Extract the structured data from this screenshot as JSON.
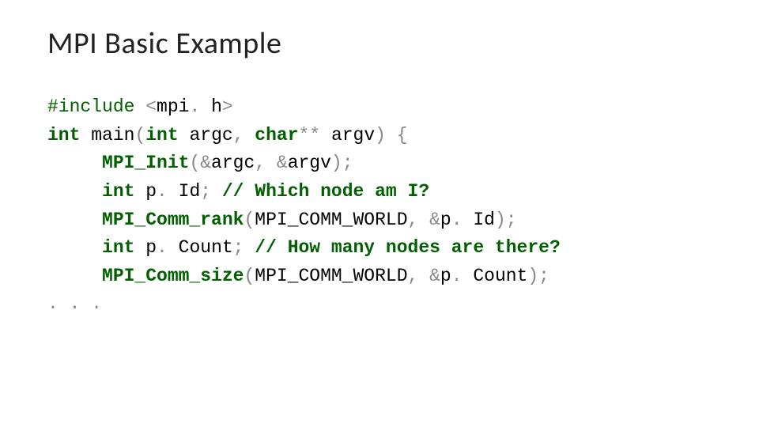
{
  "title": "MPI Basic Example",
  "code": {
    "l1_include": "#include ",
    "l1_lt": "<",
    "l1_hdr": "mpi",
    "l1_dot": ". ",
    "l1_h": "h",
    "l1_gt": ">",
    "l2_int": "int",
    "l2_main": " main",
    "l2_op": "(",
    "l2_int2": "int",
    "l2_argc": " argc",
    "l2_comma": ", ",
    "l2_char": "char",
    "l2_stars": "** ",
    "l2_argv": "argv",
    "l2_cp": ") {",
    "l3_indent": "     ",
    "l3_fn": "MPI_Init",
    "l3_op": "(&",
    "l3_argc": "argc",
    "l3_mid": ", &",
    "l3_argv": "argv",
    "l3_cp": ");",
    "l4_indent": "     ",
    "l4_int": "int",
    "l4_pid_a": " p",
    "l4_pid_dot": ". ",
    "l4_pid_b": "Id",
    "l4_semi": "; ",
    "l4_comment": "// Which node am I?",
    "l5_indent": "     ",
    "l5_fn": "MPI_Comm_rank",
    "l5_op": "(",
    "l5_world": "MPI_COMM_WORLD",
    "l5_mid": ", &",
    "l5_pid_a": "p",
    "l5_pid_dot": ". ",
    "l5_pid_b": "Id",
    "l5_cp": ");",
    "l6_indent": "     ",
    "l6_int": "int",
    "l6_pc_a": " p",
    "l6_pc_dot": ". ",
    "l6_pc_b": "Count",
    "l6_semi": "; ",
    "l6_comment": "// How many nodes are there?",
    "l7_indent": "     ",
    "l7_fn": "MPI_Comm_size",
    "l7_op": "(",
    "l7_world": "MPI_COMM_WORLD",
    "l7_mid": ", &",
    "l7_pc_a": "p",
    "l7_pc_dot": ". ",
    "l7_pc_b": "Count",
    "l7_cp": ");",
    "l8_dots": ". . ."
  }
}
